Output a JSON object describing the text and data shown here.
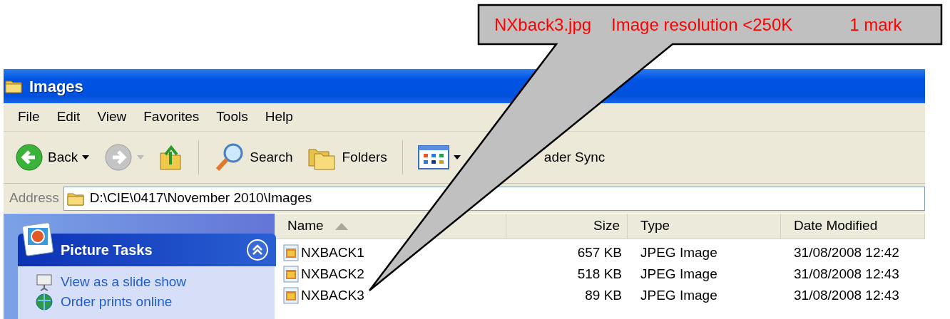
{
  "window": {
    "title": "Images"
  },
  "menu": [
    "File",
    "Edit",
    "View",
    "Favorites",
    "Tools",
    "Help"
  ],
  "toolbar": [
    {
      "kind": "back",
      "label": "Back"
    },
    {
      "kind": "forward"
    },
    {
      "kind": "up"
    },
    {
      "kind": "search",
      "label": "Search"
    },
    {
      "kind": "folders",
      "label": "Folders"
    },
    {
      "kind": "views"
    },
    {
      "kind": "text",
      "label": "ader Sync"
    }
  ],
  "address": {
    "label": "Address",
    "path": "D:\\CIE\\0417\\November 2010\\Images"
  },
  "task_panel": {
    "title": "Picture Tasks",
    "tasks": [
      {
        "kind": "slideshow",
        "label": "View as a slide show"
      },
      {
        "kind": "prints",
        "label": "Order prints online"
      }
    ]
  },
  "columns": [
    {
      "label": "Name",
      "sorted": true
    },
    {
      "label": "Size",
      "sorted": false
    },
    {
      "label": "Type",
      "sorted": false
    },
    {
      "label": "Date Modified",
      "sorted": false
    }
  ],
  "rows": [
    {
      "name": "NXBACK1",
      "size": "657 KB",
      "type": "JPEG Image",
      "date": "31/08/2008 12:42"
    },
    {
      "name": "NXBACK2",
      "size": "518 KB",
      "type": "JPEG Image",
      "date": "31/08/2008 12:43"
    },
    {
      "name": "NXBACK3",
      "size": "89 KB",
      "type": "JPEG Image",
      "date": "31/08/2008 12:43"
    }
  ],
  "callout": [
    "NXback3.jpg",
    "Image resolution <250K",
    "1 mark"
  ]
}
